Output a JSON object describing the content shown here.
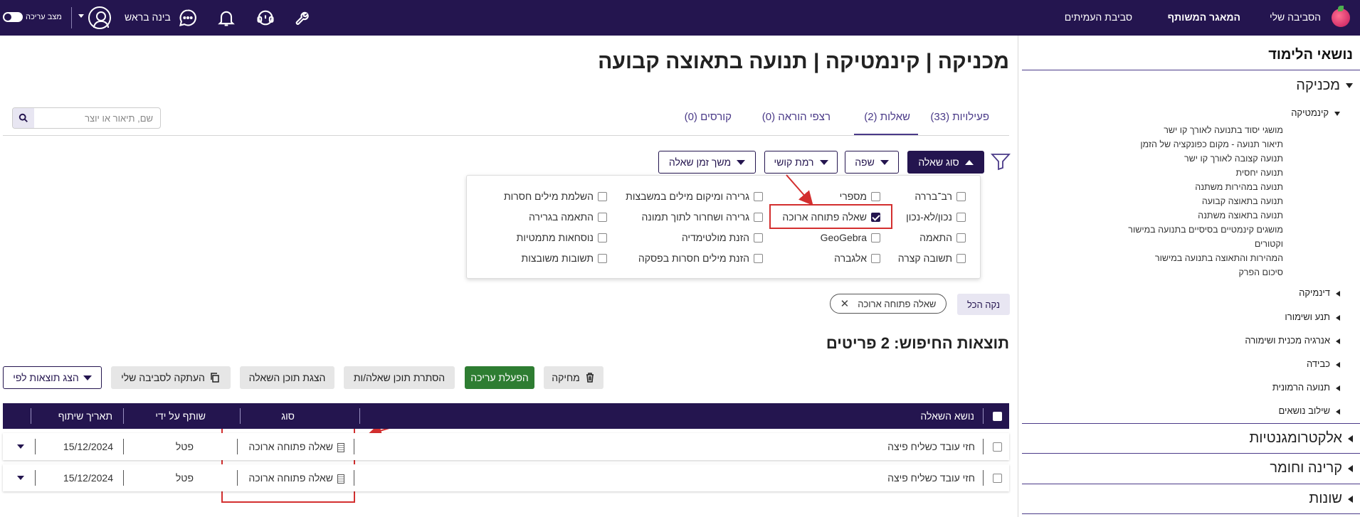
{
  "topbar": {
    "nav": [
      "הסביבה שלי",
      "המאגר המשותף",
      "סביבת העמיתים"
    ],
    "user_name": "בינה בראש",
    "edit_mode": "מצב עריכה"
  },
  "sidebar": {
    "title": "נושאי הלימוד",
    "mechanics": "מכניקה",
    "kinematics": "קינמטיקה",
    "kinematics_items": [
      "מושגי יסוד בתנועה לאורך קו ישר",
      "תיאור תנועה - מקום כפונקציה של הזמן",
      "תנועה קצובה לאורך קו ישר",
      "תנועה יחסית",
      "תנועה במהירות משתנה",
      "תנועה בתאוצה קבועה",
      "תנועה בתאוצה משתנה",
      "מושגים קינמטיים בסיסיים בתנועה במישור",
      "וקטורים",
      "המהירות והתאוצה בתנועה במישור",
      "סיכום הפרק"
    ],
    "mechanics_subs": [
      "דינמיקה",
      "תנע ושימורו",
      "אנרגיה מכנית ושימורה",
      "כבידה",
      "תנועה הרמונית",
      "שילוב נושאים"
    ],
    "top_items": [
      "אלקטרומגנטיות",
      "קרינה וחומר",
      "שונות"
    ]
  },
  "page": {
    "title": "מכניקה | קינמטיקה | תנועה בתאוצה קבועה"
  },
  "tabs": [
    "פעילויות (33)",
    "שאלות (2)",
    "רצפי הוראה (0)",
    "קורסים (0)"
  ],
  "search": {
    "placeholder": "שם, תיאור או יוצר"
  },
  "filters": {
    "question_type": "סוג שאלה",
    "language": "שפה",
    "difficulty": "רמת קושי",
    "duration": "משך זמן שאלה"
  },
  "dropdown": {
    "col1": [
      "רב־בררה",
      "נכון/לא-נכון",
      "התאמה",
      "תשובה קצרה"
    ],
    "col2": [
      "מספרי",
      "שאלה פתוחה ארוכה",
      "GeoGebra",
      "אלגברה"
    ],
    "col3": [
      "גרירה ומיקום מילים במשבצות",
      "גרירה ושחרור לתוך תמונה",
      "הזנת מולטימדיה",
      "הזנת מילים חסרות בפסקה"
    ],
    "col4": [
      "השלמת מילים חסרות",
      "התאמה בגרירה",
      "נוסחאות מתמטיות",
      "תשובות משובצות"
    ]
  },
  "active_filter_chip": "שאלה פתוחה ארוכה",
  "clear_all": "נקה הכל",
  "results": {
    "title": "תוצאות החיפוש: 2 פריטים"
  },
  "actions": {
    "delete": "מחיקה",
    "enable_edit": "הפעלת עריכה",
    "hide_content": "הסתרת תוכן שאלה/ות",
    "show_content": "הצגת תוכן השאלה",
    "copy_to_env": "העתקה לסביבה שלי",
    "sort_by": "הצג תוצאות לפי"
  },
  "table": {
    "headers": [
      "נושא השאלה",
      "סוג",
      "שותף על ידי",
      "תאריך שיתוף"
    ],
    "rows": [
      [
        "חזי עובד כשליח פיצה",
        "שאלה פתוחה ארוכה",
        "פטל",
        "15/12/2024"
      ],
      [
        "חזי עובד כשליח פיצה",
        "שאלה פתוחה ארוכה",
        "פטל",
        "15/12/2024"
      ]
    ]
  },
  "colors": {
    "brand": "#24154f",
    "accent": "#4a3a88",
    "success": "#2e7d32",
    "annotation": "#d32f2f"
  }
}
